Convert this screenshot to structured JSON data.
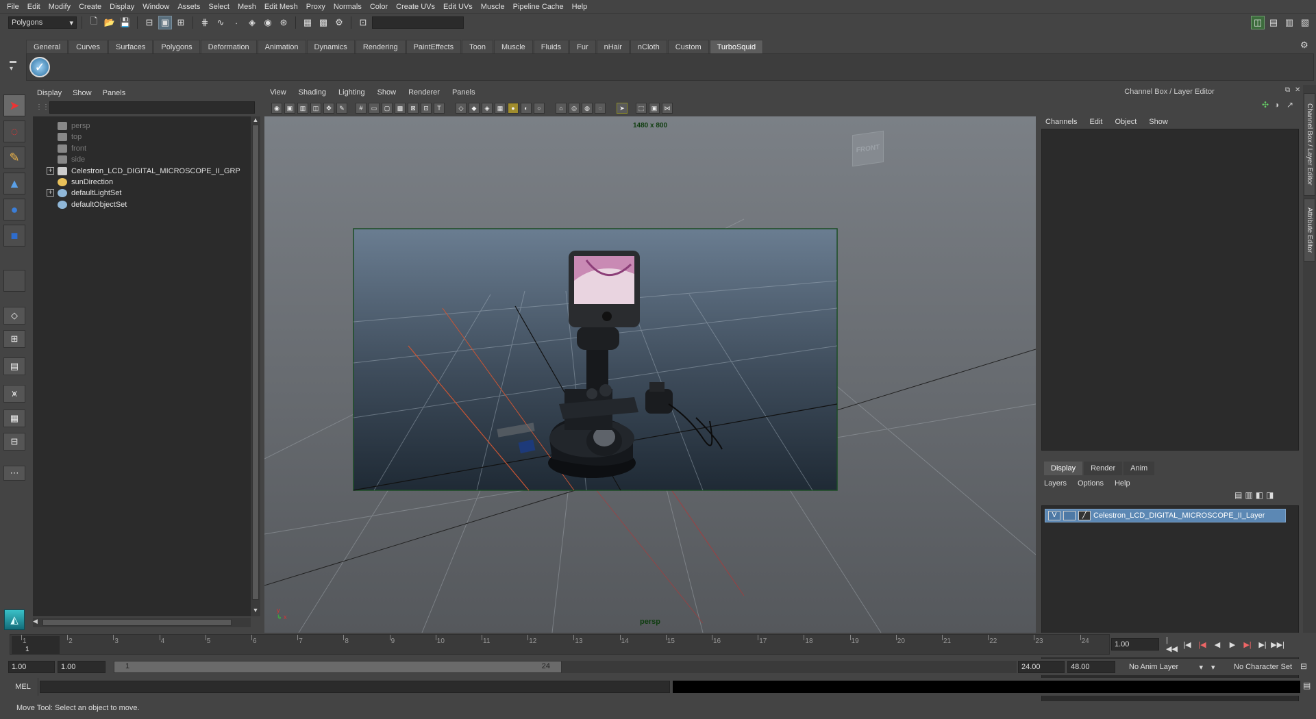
{
  "menubar": [
    "File",
    "Edit",
    "Modify",
    "Create",
    "Display",
    "Window",
    "Assets",
    "Select",
    "Mesh",
    "Edit Mesh",
    "Proxy",
    "Normals",
    "Color",
    "Create UVs",
    "Edit UVs",
    "Muscle",
    "Pipeline Cache",
    "Help"
  ],
  "status": {
    "mode": "Polygons"
  },
  "shelf_tabs": [
    "General",
    "Curves",
    "Surfaces",
    "Polygons",
    "Deformation",
    "Animation",
    "Dynamics",
    "Rendering",
    "PaintEffects",
    "Toon",
    "Muscle",
    "Fluids",
    "Fur",
    "nHair",
    "nCloth",
    "Custom",
    "TurboSquid"
  ],
  "shelf_active": "TurboSquid",
  "outliner": {
    "menu": [
      "Display",
      "Show",
      "Panels"
    ],
    "items": [
      {
        "label": "persp",
        "dim": true
      },
      {
        "label": "top",
        "dim": true
      },
      {
        "label": "front",
        "dim": true
      },
      {
        "label": "side",
        "dim": true
      },
      {
        "label": "Celestron_LCD_DIGITAL_MICROSCOPE_II_GRP",
        "dim": false,
        "expand": true
      },
      {
        "label": "sunDirection",
        "dim": false
      },
      {
        "label": "defaultLightSet",
        "dim": false,
        "expand": true
      },
      {
        "label": "defaultObjectSet",
        "dim": false
      }
    ]
  },
  "viewport": {
    "menu": [
      "View",
      "Shading",
      "Lighting",
      "Show",
      "Renderer",
      "Panels"
    ],
    "resolution": "1480 x 800",
    "camera": "persp",
    "cube_label": "FRONT"
  },
  "channelbox": {
    "title": "Channel Box / Layer Editor",
    "menu": [
      "Channels",
      "Edit",
      "Object",
      "Show"
    ],
    "layer_tabs": [
      "Display",
      "Render",
      "Anim"
    ],
    "layer_menu": [
      "Layers",
      "Options",
      "Help"
    ],
    "layer_name": "Celestron_LCD_DIGITAL_MICROSCOPE_II_Layer",
    "layer_v": "V"
  },
  "sidetabs": [
    "Channel Box / Layer Editor",
    "Attribute Editor"
  ],
  "timeline": {
    "ticks": [
      "1",
      "2",
      "3",
      "4",
      "5",
      "6",
      "7",
      "8",
      "9",
      "10",
      "11",
      "12",
      "13",
      "14",
      "15",
      "16",
      "17",
      "18",
      "19",
      "20",
      "21",
      "22",
      "23",
      "24"
    ],
    "current": "1",
    "current_field": "1.00"
  },
  "range": {
    "start": "1.00",
    "playback_start": "1.00",
    "slider_start": "1",
    "slider_end": "24",
    "playback_end": "24.00",
    "end": "48.00",
    "anim_layer": "No Anim Layer",
    "char_set": "No Character Set"
  },
  "cmd": {
    "label": "MEL"
  },
  "help": "Move Tool: Select an object to move."
}
